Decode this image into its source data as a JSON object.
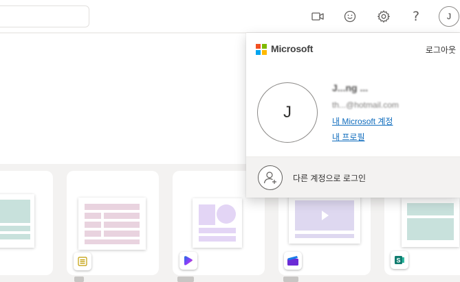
{
  "header": {
    "icons": [
      "video-camera-icon",
      "smiley-feedback-icon",
      "gear-icon",
      "question-mark-icon"
    ],
    "help_glyph": "?",
    "avatar_initial": "J"
  },
  "templates": [
    {
      "app": "forms-icon"
    },
    {
      "app": "loop-icon"
    },
    {
      "app": "clipchamp-icon"
    },
    {
      "app": "sway-icon"
    }
  ],
  "account_flyout": {
    "brand": "Microsoft",
    "sign_out": "로그아웃",
    "avatar_initial": "J",
    "user_name": "J...ng ...",
    "user_email": "th...@hotmail.com",
    "my_account_link": "내 Microsoft 계정",
    "my_profile_link": "내 프로필",
    "other_account": "다른 계정으로 로그인"
  },
  "colors": {
    "ms_red": "#f25022",
    "ms_green": "#7fba00",
    "ms_blue": "#00a4ef",
    "ms_yellow": "#ffb900",
    "link": "#0f6cbd"
  }
}
